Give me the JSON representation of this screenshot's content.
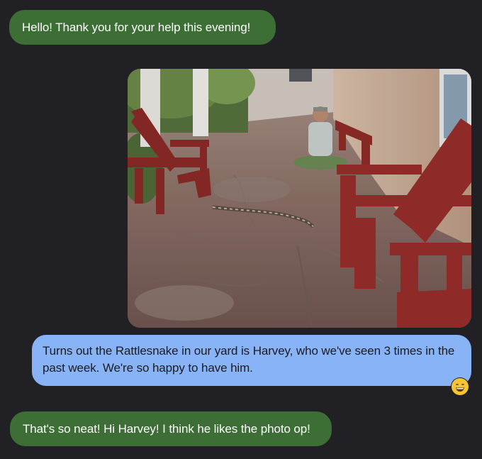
{
  "conversation": {
    "messages": [
      {
        "direction": "incoming",
        "text": "Hello! Thank you for your help this evening!"
      },
      {
        "direction": "outgoing",
        "attachment": "photo",
        "text": "Turns out the Rattlesnake in our yard is Harvey, who we've seen 3 times in the past week. We're so happy to have him.",
        "reaction": "grinning-face-emoji"
      },
      {
        "direction": "incoming",
        "text": "That's so neat! Hi Harvey! I think he likes the photo op!"
      }
    ]
  },
  "colors": {
    "background": "#212125",
    "incoming_bubble": "#3c6e35",
    "outgoing_bubble": "#88b4f7",
    "incoming_text": "#ffffff",
    "outgoing_text": "#1b1b1f"
  }
}
